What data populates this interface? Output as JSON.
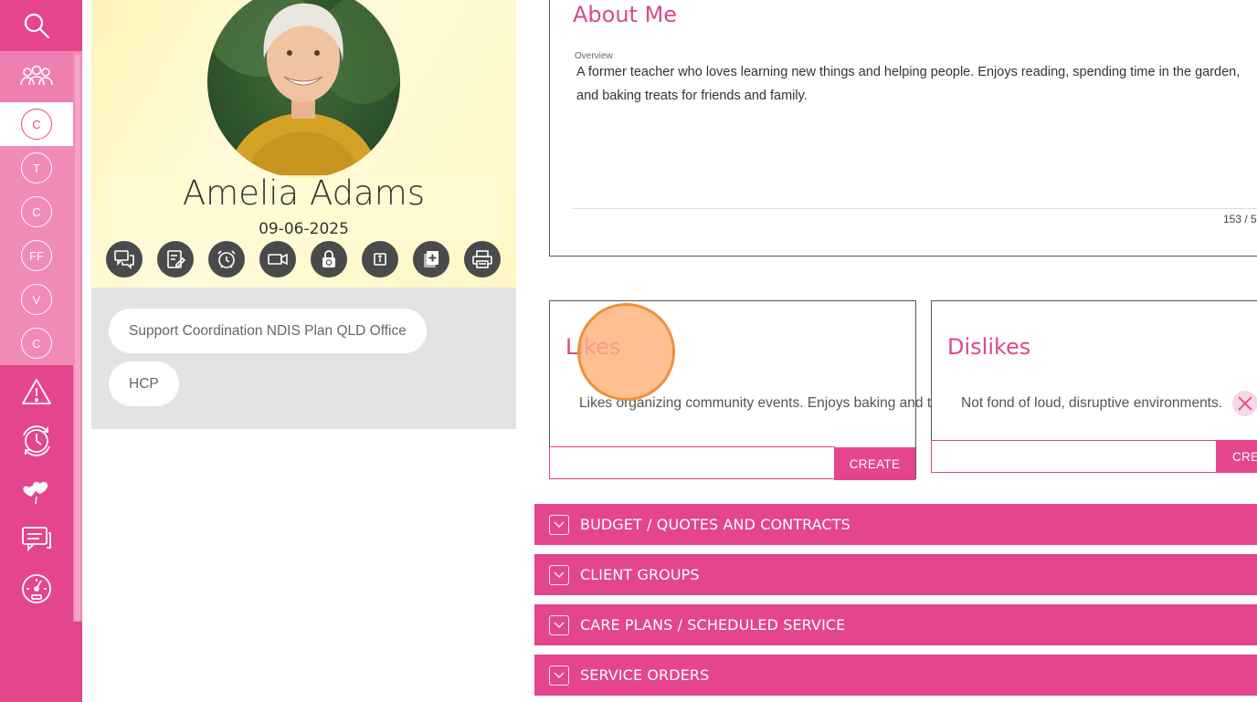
{
  "colors": {
    "brand_pink": "#e4458c",
    "title_pink": "#d94a8c",
    "dark_button": "#4a4a4a",
    "tag_bg": "#e3e3e3"
  },
  "sidebar": {
    "top_icons": [
      "search-icon",
      "people-icon"
    ],
    "sub_items": [
      {
        "letter": "C",
        "active": true
      },
      {
        "letter": "T",
        "active": false
      },
      {
        "letter": "C",
        "active": false
      },
      {
        "letter": "FF",
        "active": false
      },
      {
        "letter": "V",
        "active": false
      },
      {
        "letter": "C",
        "active": false
      }
    ],
    "bottom_icons": [
      "alert-icon",
      "cycle-clock-icon",
      "hearts-icon",
      "chat-icon",
      "gauge-icon"
    ]
  },
  "profile": {
    "name": "Amelia Adams",
    "date": "09-06-2025",
    "actions": [
      "chat-icon",
      "edit-note-icon",
      "alarm-clock-icon",
      "video-icon",
      "lock-refresh-icon",
      "info-icon",
      "add-document-icon",
      "print-icon"
    ],
    "tags": [
      "Support Coordination NDIS Plan QLD Office",
      "HCP"
    ]
  },
  "about": {
    "title": "About Me",
    "overview_label": "Overview",
    "overview_text": "A former teacher who loves learning new things and helping people. Enjoys reading, spending time in the garden, and baking treats for friends and family.",
    "char_count": "153 / 5"
  },
  "likes": {
    "title": "Likes",
    "item": "Likes organizing community events. Enjoys baking and try",
    "input_value": "",
    "create_label": "CREATE"
  },
  "dislikes": {
    "title": "Dislikes",
    "item": "Not fond of loud, disruptive environments.",
    "input_value": "",
    "create_label": "CRE"
  },
  "accordions": [
    "BUDGET / QUOTES AND CONTRACTS",
    "CLIENT GROUPS",
    "CARE PLANS / SCHEDULED SERVICE",
    "SERVICE ORDERS"
  ]
}
